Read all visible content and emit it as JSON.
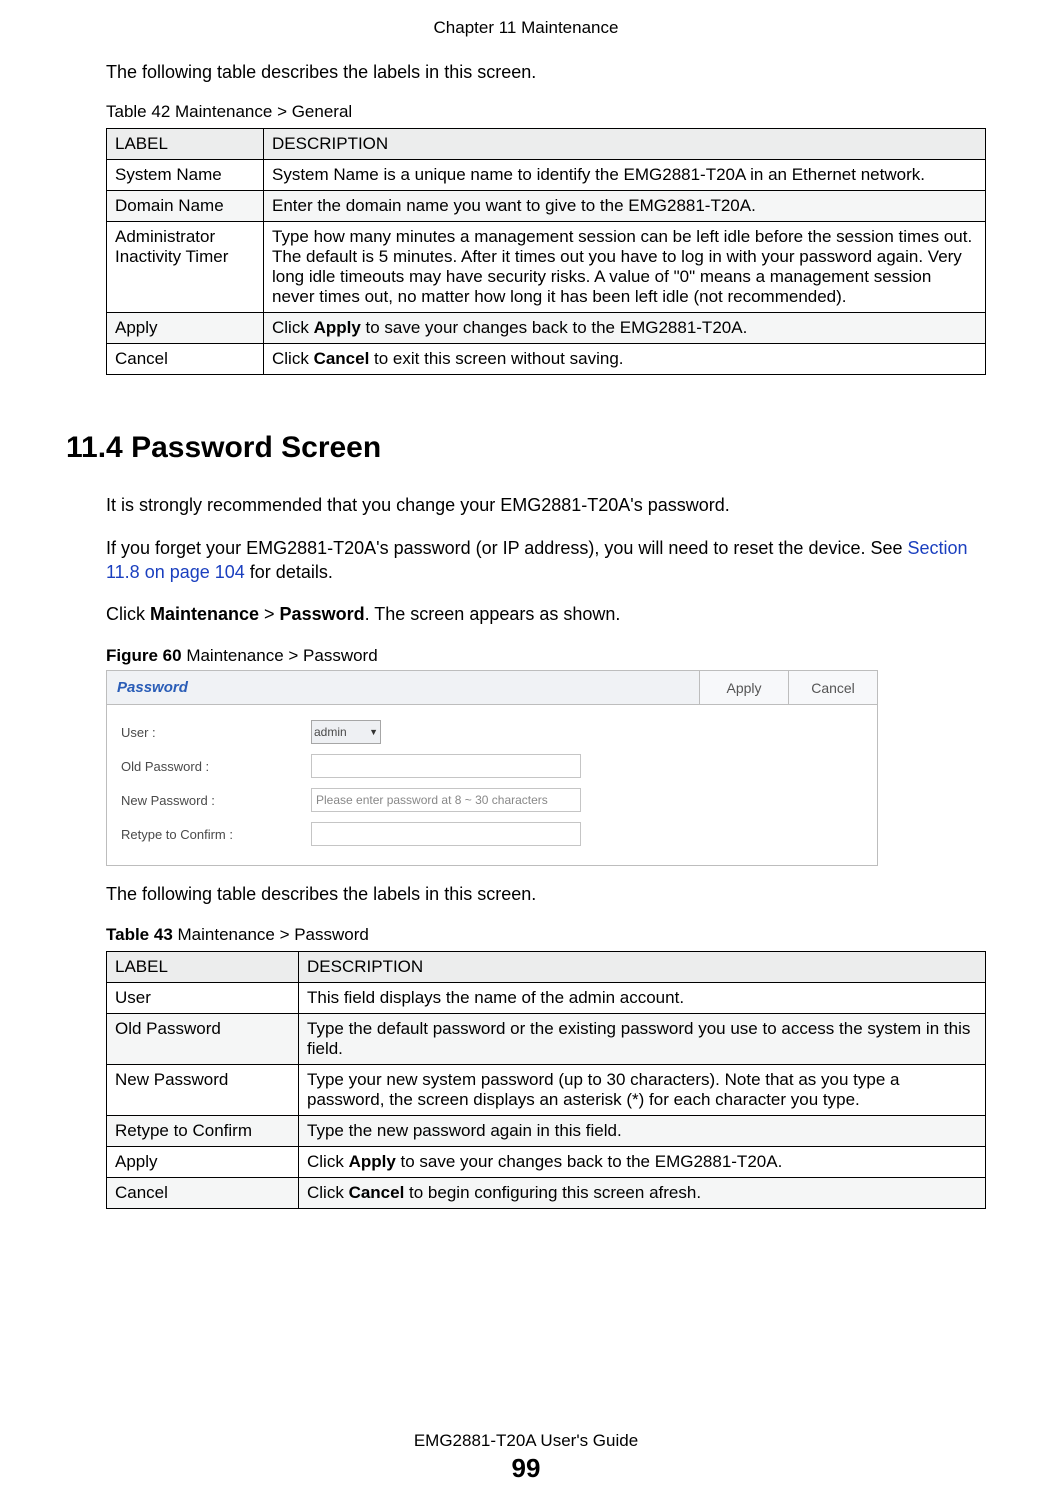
{
  "header": "Chapter 11 Maintenance",
  "intro_text_1": "The following table describes the labels in this screen.",
  "table42": {
    "caption": "Table 42   Maintenance > General",
    "head_label": "LABEL",
    "head_desc": "DESCRIPTION",
    "rows": [
      {
        "label": "System Name",
        "desc": "System Name is a unique name to identify the EMG2881-T20A in an Ethernet network."
      },
      {
        "label": "Domain Name",
        "desc": "Enter the domain name you want to give to the EMG2881-T20A."
      },
      {
        "label": "Administrator Inactivity Timer",
        "desc": "Type how many minutes a management session can be left idle before the session times out. The default is 5 minutes. After it times out you have to log in with your password again. Very long idle timeouts may have security risks. A value of \"0\" means a management session never times out, no matter how long it has been left idle (not recommended)."
      },
      {
        "label": "Apply",
        "desc_pre": "Click ",
        "desc_bold": "Apply",
        "desc_post": " to save your changes back to the EMG2881-T20A."
      },
      {
        "label": "Cancel",
        "desc_pre": "Click ",
        "desc_bold": "Cancel",
        "desc_post": " to exit this screen without saving."
      }
    ]
  },
  "section_heading": "11.4  Password Screen",
  "para1": "It is strongly recommended that you change your EMG2881-T20A's password.",
  "para2_pre": "If you forget your EMG2881-T20A's password (or IP address), you will need to reset the device. See ",
  "para2_link": "Section 11.8 on page 104",
  "para2_post": " for details.",
  "para3_pre": "Click ",
  "para3_b1": "Maintenance",
  "para3_mid": " > ",
  "para3_b2": "Password",
  "para3_post": ". The screen appears as shown.",
  "figure_caption_pre": "Figure 60",
  "figure_caption_post": "   Maintenance > Password",
  "figure": {
    "title": "Password",
    "apply": "Apply",
    "cancel": "Cancel",
    "rows": {
      "user_label": "User :",
      "user_value": "admin",
      "old_label": "Old Password :",
      "new_label": "New Password :",
      "new_placeholder": "Please enter password at 8 ~ 30 characters",
      "retype_label": "Retype to Confirm :"
    }
  },
  "intro_text_2": "The following table describes the labels in this screen.",
  "table43": {
    "caption_bold": "Table 43",
    "caption_rest": "   Maintenance > Password",
    "head_label": "LABEL",
    "head_desc": "DESCRIPTION",
    "rows": [
      {
        "label": "User",
        "desc": "This field displays the name of the admin account."
      },
      {
        "label": "Old Password",
        "desc": "Type the default password or the existing password you use to access the system in this field."
      },
      {
        "label": "New Password",
        "desc": "Type your new system password (up to 30 characters). Note that as you type a password, the screen displays an asterisk (*) for each character you type."
      },
      {
        "label": "Retype to Confirm",
        "desc": "Type the new password again in this field."
      },
      {
        "label": "Apply",
        "desc_pre": "Click ",
        "desc_bold": "Apply",
        "desc_post": " to save your changes back to the EMG2881-T20A."
      },
      {
        "label": "Cancel",
        "desc_pre": "Click ",
        "desc_bold": "Cancel",
        "desc_post": " to begin configuring this screen afresh."
      }
    ]
  },
  "footer_title": "EMG2881-T20A User's Guide",
  "footer_page": "99"
}
